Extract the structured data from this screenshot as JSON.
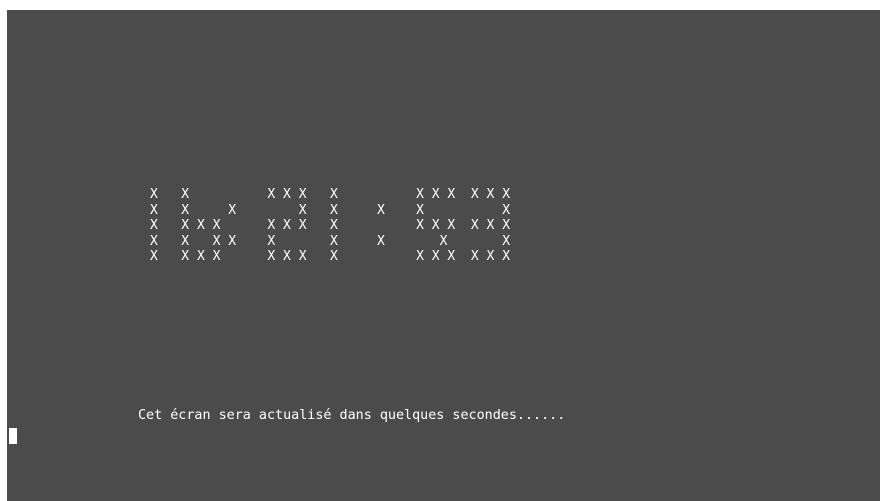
{
  "screen": {
    "background": "#4b4b4b",
    "text_color": "#ffffff",
    "clock_rows": [
      "X   X          X X X   X          X X X  X X X",
      "X   X     X        X   X     X    X          X",
      "X   X X X      X X X   X          X X X  X X X",
      "X   X   X X    X       X     X       X       X",
      "X   X X X      X X X   X          X X X  X X X"
    ],
    "message": "Cet écran sera actualisé dans quelques secondes......"
  }
}
